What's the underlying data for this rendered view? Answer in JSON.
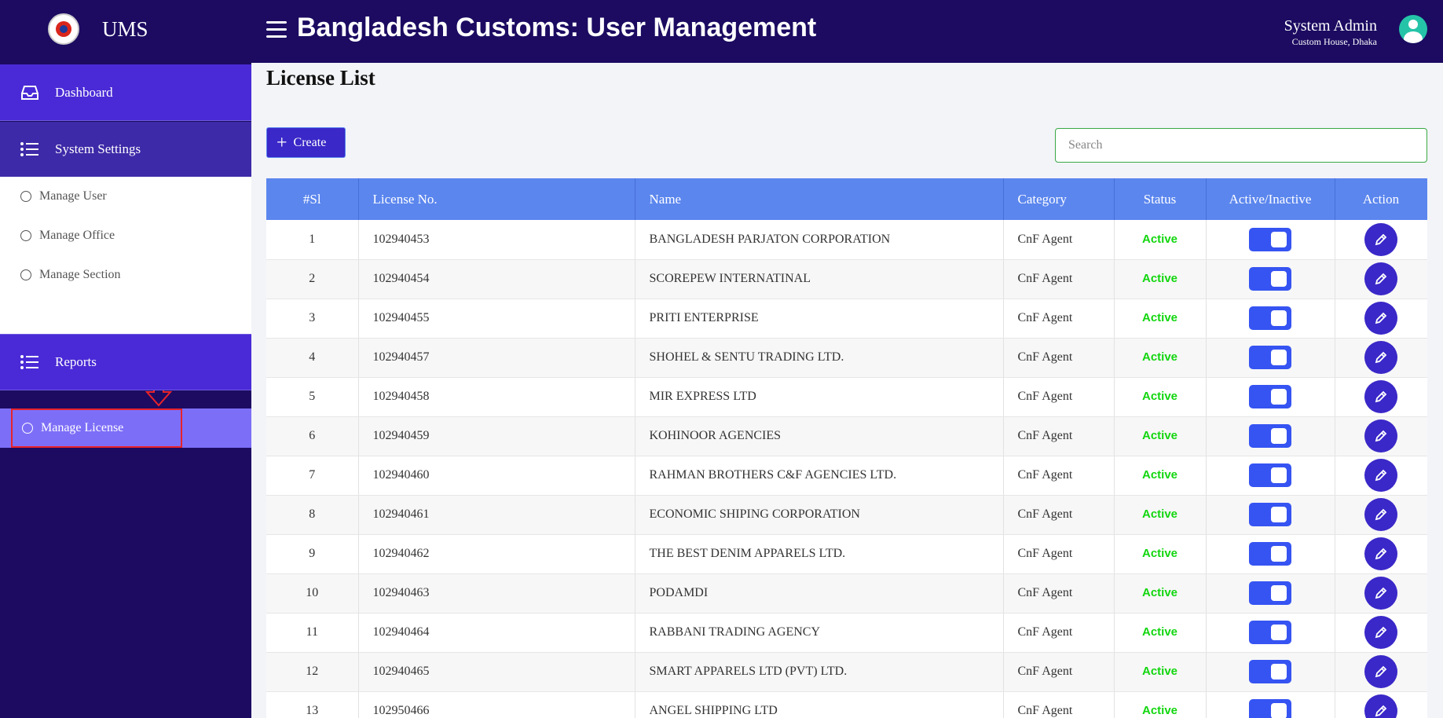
{
  "header": {
    "app_name": "UMS",
    "title": "Bangladesh Customs: User Management",
    "user_name": "System Admin",
    "user_office": "Custom House, Dhaka"
  },
  "sidebar": {
    "dashboard": "Dashboard",
    "system_settings": "System Settings",
    "submenu": [
      "Manage User",
      "Manage Office",
      "Manage Section",
      "Manage License"
    ],
    "active_submenu": "Manage License",
    "reports": "Reports"
  },
  "main": {
    "page_title": "License List",
    "create_label": "Create",
    "search_placeholder": "Search",
    "columns": [
      "#Sl",
      "License No.",
      "Name",
      "Category",
      "Status",
      "Active/Inactive",
      "Action"
    ],
    "rows": [
      {
        "sl": "1",
        "license": "102940453",
        "name": "BANGLADESH PARJATON CORPORATION",
        "category": "CnF Agent",
        "status": "Active",
        "enabled": true
      },
      {
        "sl": "2",
        "license": "102940454",
        "name": "SCOREPEW INTERNATINAL",
        "category": "CnF Agent",
        "status": "Active",
        "enabled": true
      },
      {
        "sl": "3",
        "license": "102940455",
        "name": "PRITI ENTERPRISE",
        "category": "CnF Agent",
        "status": "Active",
        "enabled": true
      },
      {
        "sl": "4",
        "license": "102940457",
        "name": "SHOHEL & SENTU TRADING LTD.",
        "category": "CnF Agent",
        "status": "Active",
        "enabled": true
      },
      {
        "sl": "5",
        "license": "102940458",
        "name": "MIR EXPRESS LTD",
        "category": "CnF Agent",
        "status": "Active",
        "enabled": true
      },
      {
        "sl": "6",
        "license": "102940459",
        "name": "KOHINOOR AGENCIES",
        "category": "CnF Agent",
        "status": "Active",
        "enabled": true
      },
      {
        "sl": "7",
        "license": "102940460",
        "name": "RAHMAN BROTHERS C&F AGENCIES LTD.",
        "category": "CnF Agent",
        "status": "Active",
        "enabled": true
      },
      {
        "sl": "8",
        "license": "102940461",
        "name": "ECONOMIC SHIPING CORPORATION",
        "category": "CnF Agent",
        "status": "Active",
        "enabled": true
      },
      {
        "sl": "9",
        "license": "102940462",
        "name": "THE BEST DENIM APPARELS LTD.",
        "category": "CnF Agent",
        "status": "Active",
        "enabled": true
      },
      {
        "sl": "10",
        "license": "102940463",
        "name": "PODAMDI",
        "category": "CnF Agent",
        "status": "Active",
        "enabled": true
      },
      {
        "sl": "11",
        "license": "102940464",
        "name": "RABBANI TRADING AGENCY",
        "category": "CnF Agent",
        "status": "Active",
        "enabled": true
      },
      {
        "sl": "12",
        "license": "102940465",
        "name": "SMART APPARELS LTD (PVT) LTD.",
        "category": "CnF Agent",
        "status": "Active",
        "enabled": true
      },
      {
        "sl": "13",
        "license": "102950466",
        "name": "ANGEL SHIPPING LTD",
        "category": "CnF Agent",
        "status": "Active",
        "enabled": true
      }
    ]
  },
  "colors": {
    "topbar": "#1c0b61",
    "accent": "#3a28c8",
    "table_header": "#5b86ee",
    "status_active": "#12d60e",
    "toggle_on": "#3654f2"
  }
}
